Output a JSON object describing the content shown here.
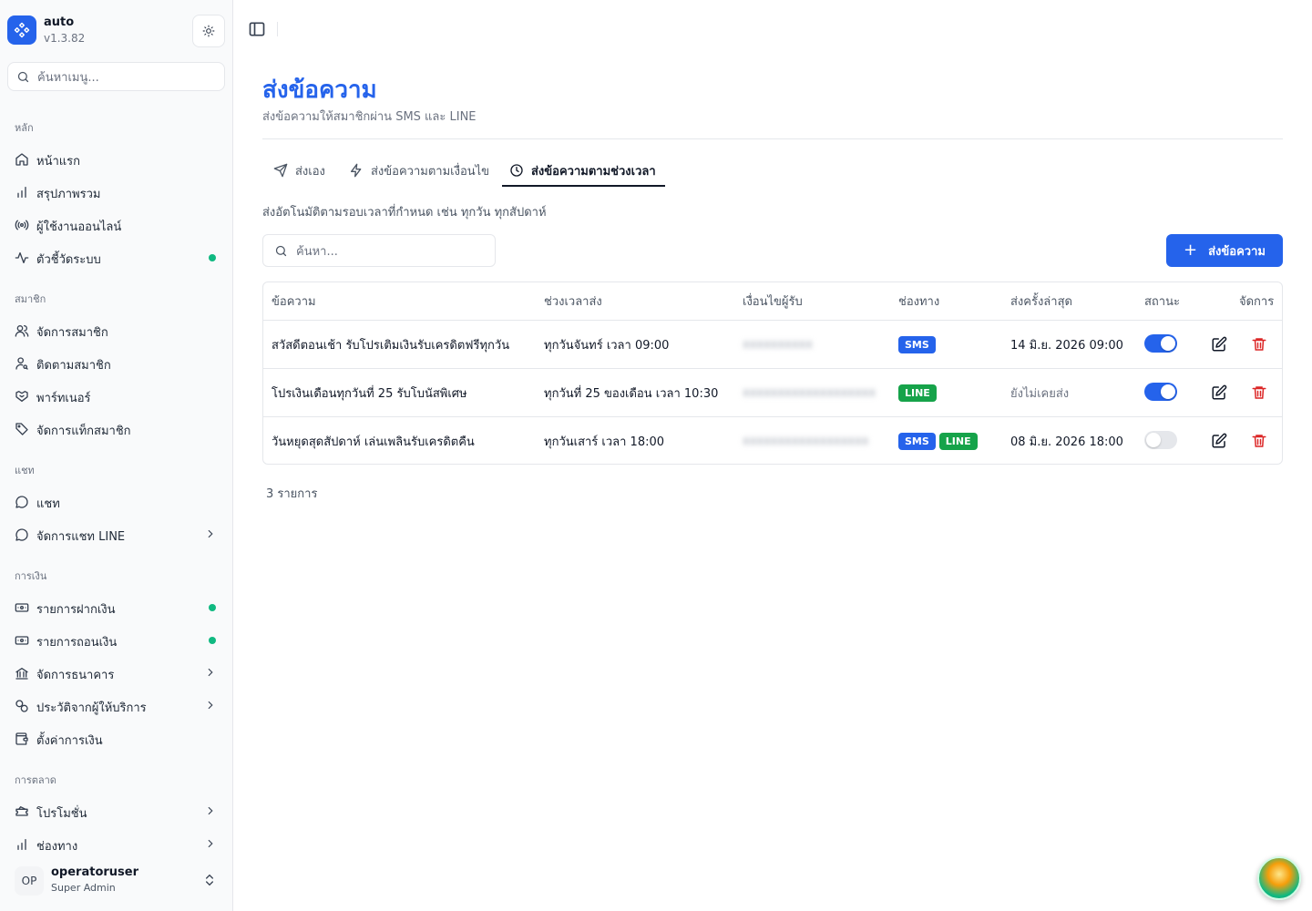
{
  "app": {
    "name": "auto",
    "version": "v1.3.82"
  },
  "sidebar": {
    "search_placeholder": "ค้นหาเมนู...",
    "sections": {
      "main": "หลัก",
      "members": "สมาชิก",
      "chat": "แชท",
      "finance": "การเงิน",
      "marketing": "การตลาด"
    },
    "items": {
      "home": "หน้าแรก",
      "overview": "สรุปภาพรวม",
      "online_users": "ผู้ใช้งานออนไลน์",
      "system_metrics": "ตัวชี้วัดระบบ",
      "manage_members": "จัดการสมาชิก",
      "track_members": "ติดตามสมาชิก",
      "partners": "พาร์ทเนอร์",
      "member_tags": "จัดการแท็กสมาชิก",
      "chat": "แชท",
      "line_chat": "จัดการแชท LINE",
      "deposits": "รายการฝากเงิน",
      "withdrawals": "รายการถอนเงิน",
      "banks": "จัดการธนาคาร",
      "provider_history": "ประวัติจากผู้ให้บริการ",
      "finance_settings": "ตั้งค่าการเงิน",
      "promotions": "โปรโมชั่น",
      "channels": "ช่องทาง"
    },
    "status_color": "#10b981"
  },
  "user": {
    "initials": "OP",
    "name": "operatoruser",
    "role": "Super Admin"
  },
  "page": {
    "title": "ส่งข้อความ",
    "subtitle": "ส่งข้อความให้สมาชิกผ่าน SMS และ LINE",
    "tabs": {
      "manual": "ส่งเอง",
      "conditional": "ส่งข้อความตามเงื่อนไข",
      "scheduled": "ส่งข้อความตามช่วงเวลา"
    },
    "active_tab": "scheduled",
    "tab_description": "ส่งอัตโนมัติตามรอบเวลาที่กำหนด เช่น ทุกวัน ทุกสัปดาห์",
    "search_placeholder": "ค้นหา...",
    "add_button": "ส่งข้อความ",
    "accent_color": "#2563eb"
  },
  "table": {
    "headers": {
      "message": "ข้อความ",
      "schedule": "ช่วงเวลาส่ง",
      "condition": "เงื่อนไขผู้รับ",
      "channel": "ช่องทาง",
      "last_sent": "ส่งครั้งล่าสุด",
      "status": "สถานะ",
      "actions": "จัดการ"
    },
    "rows": [
      {
        "message": "สวัสดีตอนเช้า รับโปรเติมเงินรับเครดิตฟรีทุกวัน",
        "schedule": "ทุกวันจันทร์ เวลา 09:00",
        "condition": "xxxxxxxxxx",
        "channels": [
          "SMS"
        ],
        "last_sent": "14 มิ.ย. 2026 09:00",
        "enabled": true
      },
      {
        "message": "โปรเงินเดือนทุกวันที่ 25 รับโบนัสพิเศษ",
        "schedule": "ทุกวันที่ 25 ของเดือน เวลา 10:30",
        "condition": "xxxxxxxxxxxxxxxxxxx",
        "channels": [
          "LINE"
        ],
        "last_sent": "ยังไม่เคยส่ง",
        "enabled": true
      },
      {
        "message": "วันหยุดสุดสัปดาห์ เล่นเพลินรับเครดิตคืน",
        "schedule": "ทุกวันเสาร์ เวลา 18:00",
        "condition": "xxxxxxxxxxxxxxxxxx",
        "channels": [
          "SMS",
          "LINE"
        ],
        "last_sent": "08 มิ.ย. 2026 18:00",
        "enabled": false
      }
    ],
    "count_label": "3 รายการ"
  }
}
